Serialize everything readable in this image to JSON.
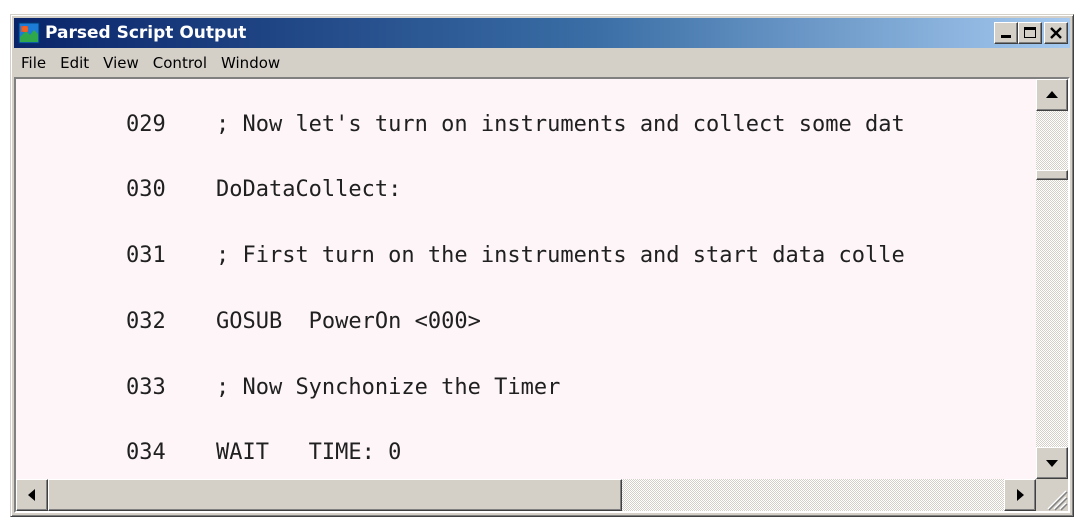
{
  "window": {
    "title": "Parsed Script Output",
    "icon": "script-app-icon",
    "controls": [
      "minimize-icon",
      "maximize-icon",
      "close-icon"
    ]
  },
  "menu": [
    "File",
    "Edit",
    "View",
    "Control",
    "Window"
  ],
  "script_lines": [
    {
      "number": "029",
      "text": "; Now let's turn on instruments and collect some dat"
    },
    {
      "number": "030",
      "text": "DoDataCollect:"
    },
    {
      "number": "031",
      "text": "; First turn on the instruments and start data colle"
    },
    {
      "number": "032",
      "text": "GOSUB  PowerOn <000>"
    },
    {
      "number": "033",
      "text": "; Now Synchonize the Timer"
    },
    {
      "number": "034",
      "text": "WAIT   TIME: 0"
    }
  ],
  "scrollbars": {
    "vertical_position": 0.18,
    "horizontal_visible_fraction": 0.6
  },
  "colors": {
    "title_active": "#0a246a",
    "title_gradient_end": "#a6caf0",
    "chrome": "#d4d0c8",
    "text_background": "#fdf5f8"
  }
}
